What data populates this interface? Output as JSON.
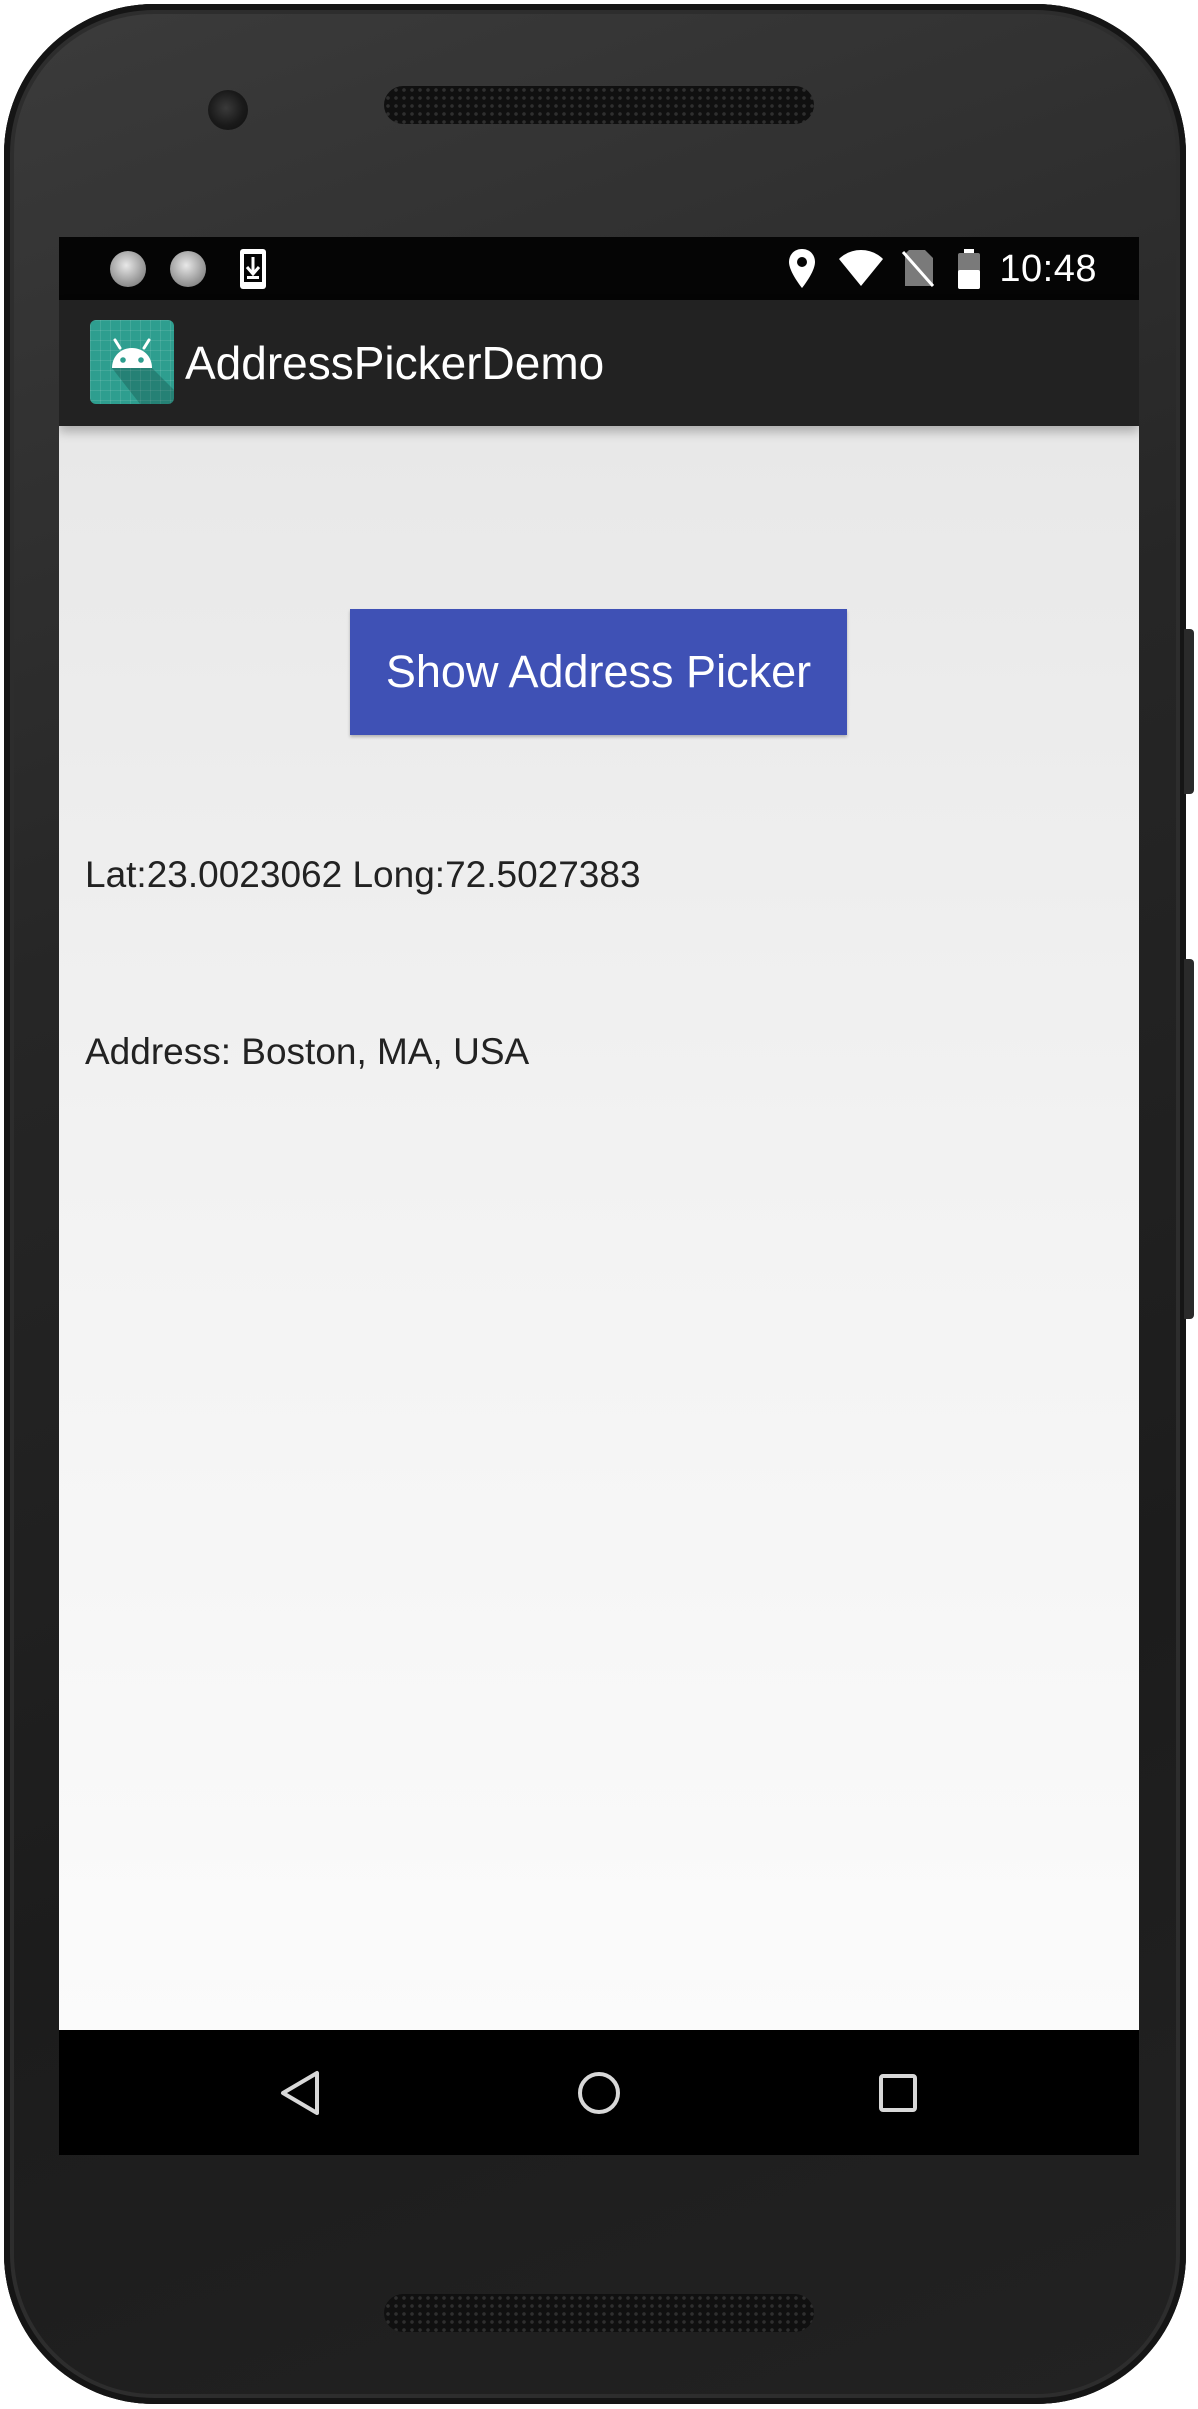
{
  "status_bar": {
    "time": "10:48",
    "notification_icons": [
      "sync-icon",
      "sync-icon",
      "download-icon"
    ],
    "system_icons": [
      "location-pin-icon",
      "wifi-icon",
      "no-sim-icon",
      "battery-icon"
    ]
  },
  "app_bar": {
    "title": "AddressPickerDemo",
    "icon": "android-app-icon"
  },
  "main": {
    "show_picker_button_label": "Show Address Picker",
    "coordinates_text": "Lat:23.0023062  Long:72.5027383",
    "address_text": "Address: Boston, MA, USA"
  },
  "nav_bar": {
    "buttons": [
      "back",
      "home",
      "recent-apps"
    ]
  },
  "colors": {
    "primary_button": "#3f51b5",
    "app_bar": "#222222",
    "status_bar": "#050505",
    "content_background": "#f0f0f0",
    "app_icon": "#2e9e8f"
  }
}
